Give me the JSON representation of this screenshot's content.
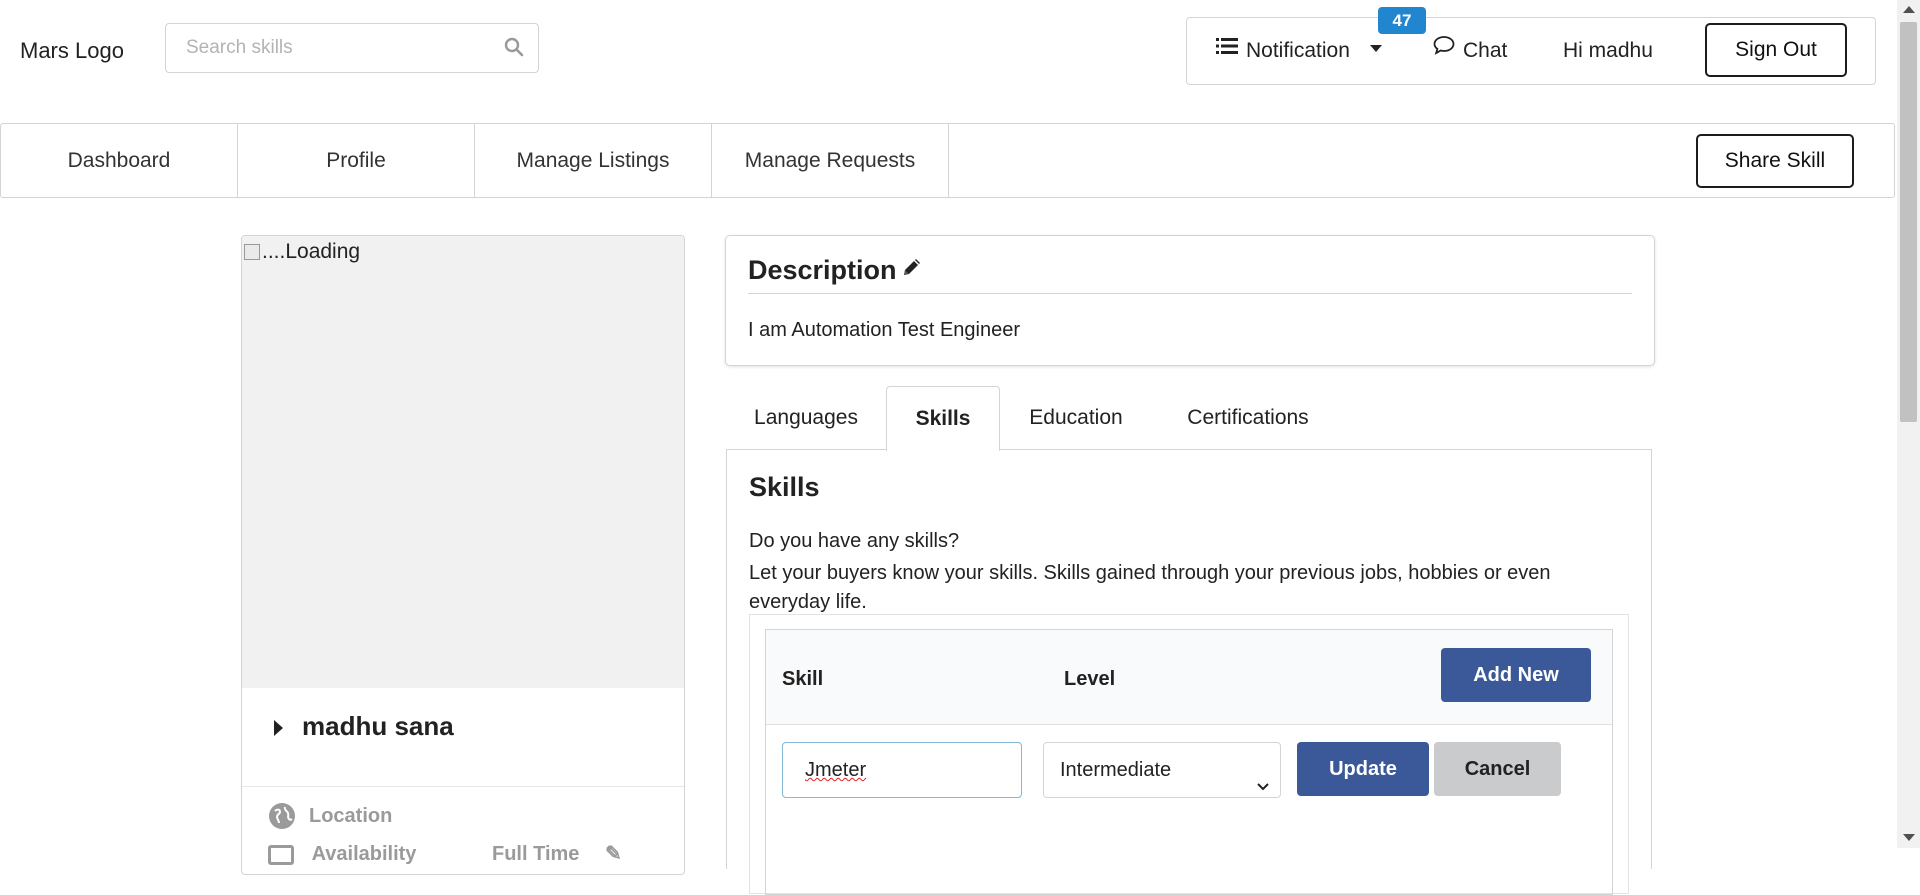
{
  "header": {
    "logo": "Mars Logo",
    "search_placeholder": "Search skills",
    "notification_label": "Notification",
    "notification_count": "47",
    "chat_label": "Chat",
    "greeting": "Hi madhu",
    "signout_label": "Sign Out"
  },
  "nav": {
    "items": [
      {
        "label": "Dashboard"
      },
      {
        "label": "Profile"
      },
      {
        "label": "Manage Listings"
      },
      {
        "label": "Manage Requests"
      }
    ],
    "share_label": "Share Skill"
  },
  "profile": {
    "image_alt": "....Loading",
    "name": "madhu sana",
    "location_label": "Location",
    "availability_label": "Availability",
    "availability_value": "Full Time"
  },
  "description": {
    "title": "Description",
    "text": "I am Automation Test Engineer"
  },
  "tabs": [
    {
      "label": "Languages"
    },
    {
      "label": "Skills"
    },
    {
      "label": "Education"
    },
    {
      "label": "Certifications"
    }
  ],
  "skills": {
    "title": "Skills",
    "question": "Do you have any skills?",
    "help": "Let your buyers know your skills. Skills gained through your previous jobs, hobbies or even everyday life.",
    "col_skill": "Skill",
    "col_level": "Level",
    "add_new_label": "Add New",
    "edit_skill_value": "Jmeter",
    "edit_level_value": "Intermediate",
    "update_label": "Update",
    "cancel_label": "Cancel"
  },
  "colors": {
    "primary_button": "#3b5998",
    "badge": "#2185d0",
    "cancel_button": "#cacbcd"
  }
}
